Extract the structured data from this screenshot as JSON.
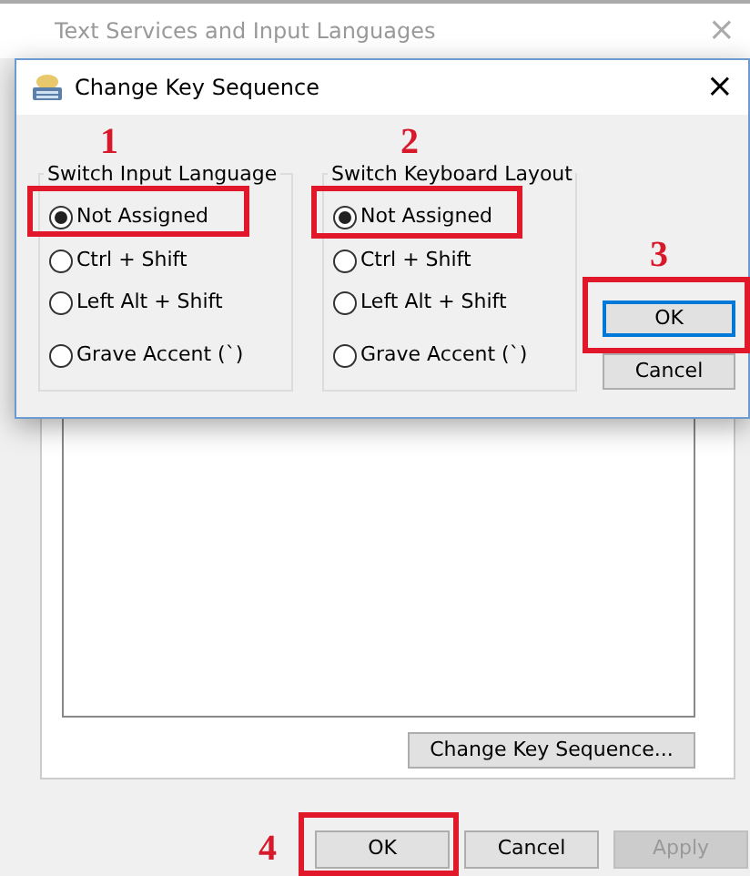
{
  "window": {
    "title": "Text Services and Input Languages",
    "close": "×"
  },
  "settings_button": {
    "label": "Change Key Sequence..."
  },
  "footer_buttons": [
    {
      "label": "OK",
      "disabled": false
    },
    {
      "label": "Cancel",
      "disabled": false
    },
    {
      "label": "Apply",
      "disabled": true
    }
  ],
  "dialog": {
    "title": "Change Key Sequence",
    "close": "×",
    "groups": [
      {
        "title": "Switch Input Language",
        "options": [
          {
            "label": "Not Assigned",
            "selected": true
          },
          {
            "label": "Ctrl + Shift",
            "selected": false
          },
          {
            "label": "Left Alt + Shift",
            "selected": false
          },
          {
            "label": "Grave Accent (`)",
            "selected": false
          }
        ]
      },
      {
        "title": "Switch Keyboard Layout",
        "options": [
          {
            "label": "Not Assigned",
            "selected": true
          },
          {
            "label": "Ctrl + Shift",
            "selected": false
          },
          {
            "label": "Left Alt + Shift",
            "selected": false
          },
          {
            "label": "Grave Accent (`)",
            "selected": false
          }
        ]
      }
    ],
    "buttons": [
      {
        "label": "OK",
        "default": true
      },
      {
        "label": "Cancel",
        "default": false
      }
    ]
  },
  "annotations": [
    {
      "label": "1"
    },
    {
      "label": "2"
    },
    {
      "label": "3"
    },
    {
      "label": "4"
    }
  ]
}
